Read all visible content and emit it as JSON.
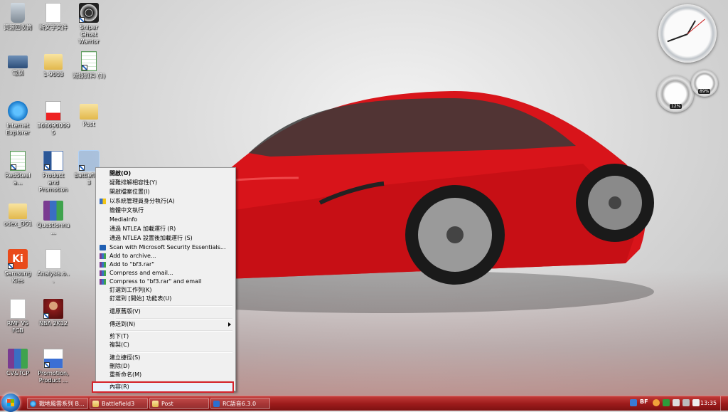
{
  "desktop": {
    "icons": [
      {
        "label": "資源回收筒"
      },
      {
        "label": "新文字文件"
      },
      {
        "label": "Sniper Ghost Warrior"
      },
      {
        "label": "電腦"
      },
      {
        "label": "1-9003"
      },
      {
        "label": "附錄資料 (1)"
      },
      {
        "label": "Internet Explorer"
      },
      {
        "label": "3686900095"
      },
      {
        "label": "Post"
      },
      {
        "label": "RedSteel a..."
      },
      {
        "label": "Product and Promotion"
      },
      {
        "label": "Battlefield 3"
      },
      {
        "label": "odex_D51"
      },
      {
        "label": "Questionna..."
      },
      {
        "label": "Samsung Kies"
      },
      {
        "label": "Analysis.o..."
      },
      {
        "label": "RMF VS FCB"
      },
      {
        "label": "NBA 2K12"
      },
      {
        "label": "CV&TCP"
      },
      {
        "label": "Promotion, Product ..."
      }
    ]
  },
  "gadgets": {
    "cpu_percent": "12%",
    "mem_percent": "89%"
  },
  "context_menu": {
    "items": [
      {
        "label": "開啟(O)"
      },
      {
        "label": "疑難排解相容性(Y)"
      },
      {
        "label": "開啟檔案位置(I)"
      },
      {
        "label": "以系統管理員身分執行(A)"
      },
      {
        "label": "簡體中文執行"
      },
      {
        "label": "MediaInfo"
      },
      {
        "label": "通過 NTLEA 加載運行 (R)"
      },
      {
        "label": "通過 NTLEA 設置後加載運行 (S)"
      },
      {
        "label": "Scan with Microsoft Security Essentials..."
      },
      {
        "label": "Add to archive..."
      },
      {
        "label": "Add to \"bf3.rar\""
      },
      {
        "label": "Compress and email..."
      },
      {
        "label": "Compress to \"bf3.rar\" and email"
      },
      {
        "label": "釘選到工作列(K)"
      },
      {
        "label": "釘選到 [開始] 功能表(U)"
      },
      {
        "label": "還原舊版(V)"
      },
      {
        "label": "傳送到(N)"
      },
      {
        "label": "剪下(T)"
      },
      {
        "label": "複製(C)"
      },
      {
        "label": "建立捷徑(S)"
      },
      {
        "label": "刪除(D)"
      },
      {
        "label": "重新命名(M)"
      },
      {
        "label": "內容(R)"
      }
    ],
    "highlight_color": "#d5232b"
  },
  "taskbar": {
    "buttons": [
      {
        "label": "戰地風雲系列 B..."
      },
      {
        "label": "Battlefield3"
      },
      {
        "label": "Post"
      },
      {
        "label": "RC語音6.3.0"
      }
    ],
    "tray_input": "BF",
    "clock": "13:35"
  }
}
